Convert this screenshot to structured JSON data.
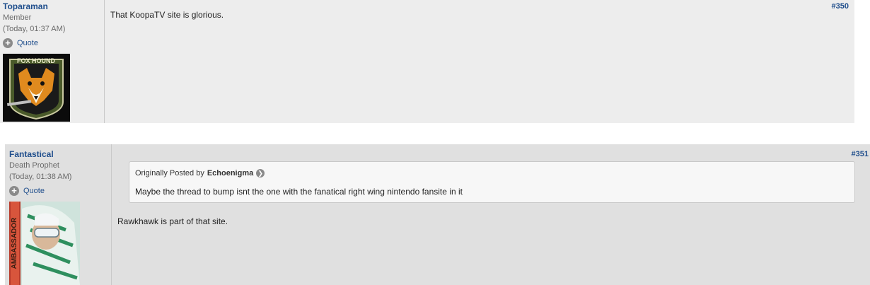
{
  "posts": [
    {
      "username": "Toparaman",
      "user_title": "Member",
      "time": "(Today, 01:37 AM)",
      "quote_label": "Quote",
      "post_number": "#350",
      "message": "That KoopaTV site is glorious.",
      "avatar_badge_text": "FOX HOUND"
    },
    {
      "username": "Fantastical",
      "user_title": "Death Prophet",
      "time": "(Today, 01:38 AM)",
      "quote_label": "Quote",
      "post_number": "#351",
      "quoted": {
        "prefix": "Originally Posted by",
        "author": "Echoenigma",
        "text": "Maybe the thread to bump isnt the one with the fanatical right wing nintendo fansite in it"
      },
      "message": "Rawkhawk is part of that site.",
      "avatar_badge_text": "AMBASSADOR"
    }
  ],
  "colors": {
    "link": "#1f4e8c",
    "post_bg_a": "#ededed",
    "post_bg_b": "#e0e0e0"
  }
}
